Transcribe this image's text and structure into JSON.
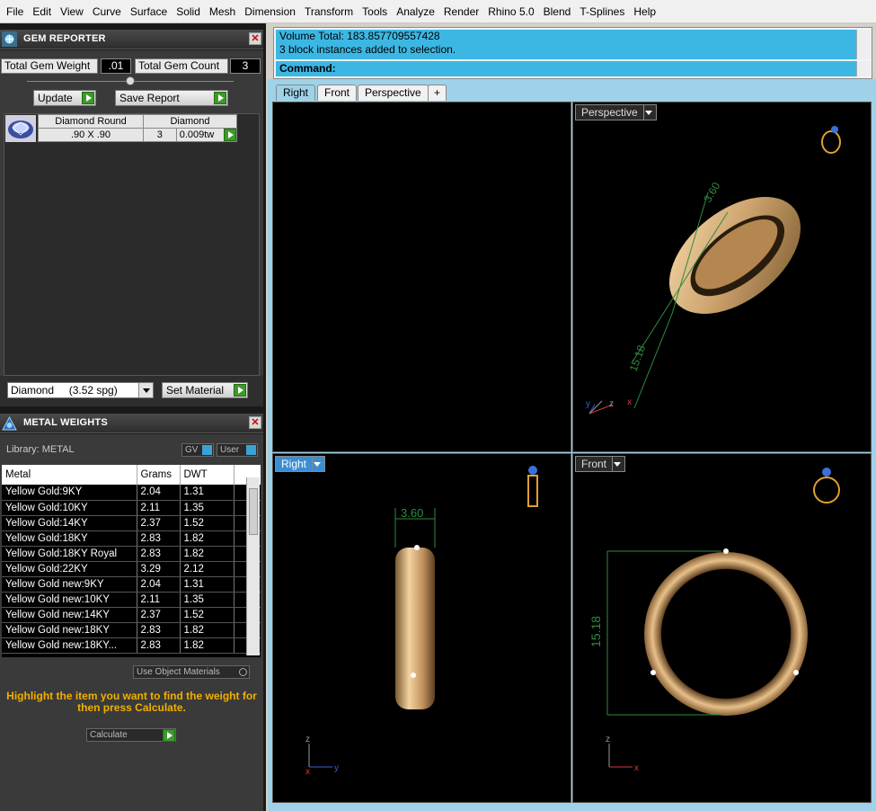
{
  "menu": [
    "File",
    "Edit",
    "View",
    "Curve",
    "Surface",
    "Solid",
    "Mesh",
    "Dimension",
    "Transform",
    "Tools",
    "Analyze",
    "Render",
    "Rhino 5.0",
    "Blend",
    "T-Splines",
    "Help"
  ],
  "gem_reporter": {
    "title": "GEM REPORTER",
    "total_weight_label": "Total Gem Weight",
    "total_weight_value": ".01",
    "total_count_label": "Total Gem Count",
    "total_count_value": "3",
    "update_label": "Update",
    "save_report_label": "Save Report",
    "gem_shape": "Diamond Round",
    "gem_material": "Diamond",
    "gem_size": ".90 X .90",
    "gem_count": "3",
    "gem_weight": "0.009tw"
  },
  "material": {
    "selected": "Diamond     (3.52 spg)",
    "set_label": "Set Material"
  },
  "metal_weights": {
    "title": "METAL WEIGHTS",
    "library_label": "Library: METAL",
    "gv_label": "GV",
    "user_label": "User",
    "columns": [
      "Metal",
      "Grams",
      "DWT"
    ],
    "rows": [
      [
        "Yellow Gold:9KY",
        "2.04",
        "1.31"
      ],
      [
        "Yellow Gold:10KY",
        "2.11",
        "1.35"
      ],
      [
        "Yellow Gold:14KY",
        "2.37",
        "1.52"
      ],
      [
        "Yellow Gold:18KY",
        "2.83",
        "1.82"
      ],
      [
        "Yellow Gold:18KY Royal",
        "2.83",
        "1.82"
      ],
      [
        "Yellow Gold:22KY",
        "3.29",
        "2.12"
      ],
      [
        "Yellow Gold new:9KY",
        "2.04",
        "1.31"
      ],
      [
        "Yellow Gold new:10KY",
        "2.11",
        "1.35"
      ],
      [
        "Yellow Gold new:14KY",
        "2.37",
        "1.52"
      ],
      [
        "Yellow Gold new:18KY",
        "2.83",
        "1.82"
      ],
      [
        "Yellow Gold new:18KY...",
        "2.83",
        "1.82"
      ]
    ],
    "use_object_label": "Use Object Materials",
    "hint": "Highlight the item you want to find the weight for then press Calculate.",
    "calculate_label": "Calculate"
  },
  "command": {
    "line1": "Volume Total: 183.857709557428",
    "line2": "3 block instances added to selection.",
    "prompt": "Command:"
  },
  "tabs": [
    "Right",
    "Front",
    "Perspective"
  ],
  "viewports": {
    "perspective": {
      "label": "Perspective",
      "dim_width": "3.60",
      "dim_height": "15.18"
    },
    "right": {
      "label": "Right",
      "dim_width": "3.60"
    },
    "front": {
      "label": "Front",
      "dim_height": "15.18"
    }
  },
  "colors": {
    "cmd_bg": "#3cb7e3",
    "viewport_bg": "#000000",
    "gold": "#e8c08a",
    "dim_green": "#2e8b3e"
  }
}
